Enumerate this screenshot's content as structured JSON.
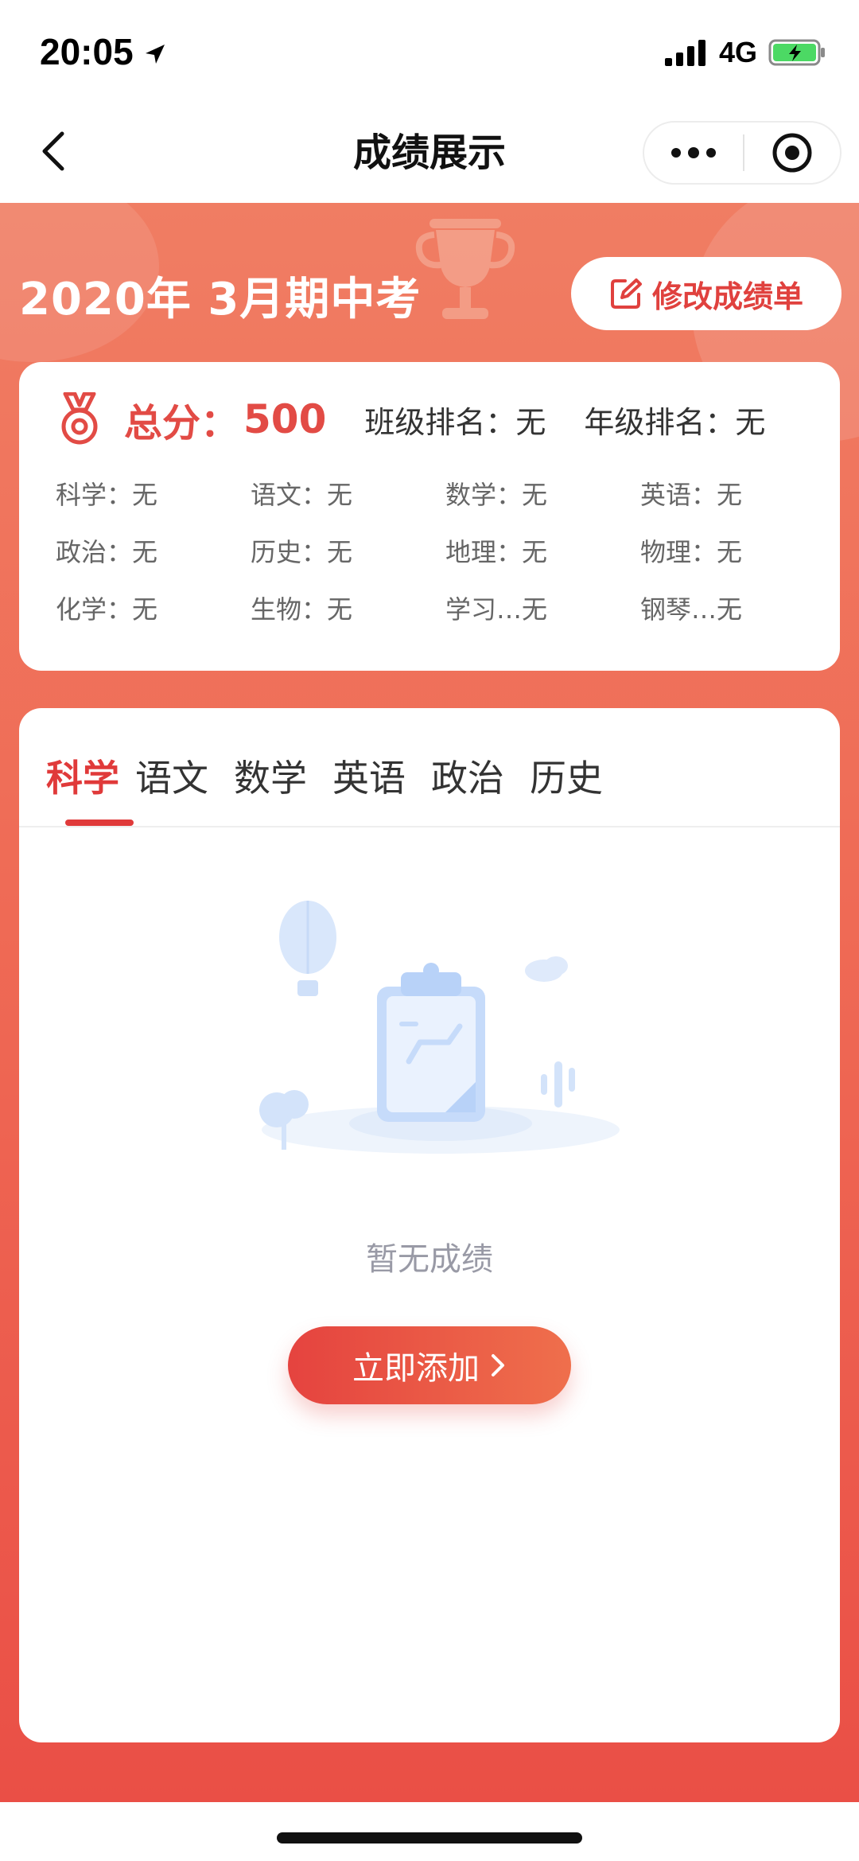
{
  "status_bar": {
    "time": "20:05",
    "network": "4G",
    "icons": [
      "location-arrow-icon",
      "signal-icon",
      "battery-charging-icon"
    ]
  },
  "nav": {
    "title": "成绩展示",
    "back_icon": "chevron-left-icon",
    "more_icon": "more-dots-icon",
    "target_icon": "target-icon"
  },
  "exam": {
    "title": "2020年  3月期中考",
    "edit_label": "修改成绩单",
    "edit_icon": "edit-icon"
  },
  "summary": {
    "total_label": "总分：",
    "total_value": "500",
    "class_rank": "班级排名：无",
    "grade_rank": "年级排名：无",
    "subjects": [
      "科学：无",
      "语文：无",
      "数学：无",
      "英语：无",
      "政治：无",
      "历史：无",
      "地理：无",
      "物理：无",
      "化学：无",
      "生物：无",
      "学习…无",
      "钢琴…无"
    ]
  },
  "tabs": [
    {
      "label": "科学",
      "active": true
    },
    {
      "label": "语文",
      "active": false
    },
    {
      "label": "数学",
      "active": false
    },
    {
      "label": "英语",
      "active": false
    },
    {
      "label": "政治",
      "active": false
    },
    {
      "label": "历史",
      "active": false
    }
  ],
  "empty_state": {
    "text": "暂无成绩",
    "button_label": "立即添加",
    "button_icon": "chevron-right-icon"
  },
  "colors": {
    "accent": "#e03a3a",
    "background_top": "#f07d63",
    "background_bottom": "#ea4f46"
  }
}
